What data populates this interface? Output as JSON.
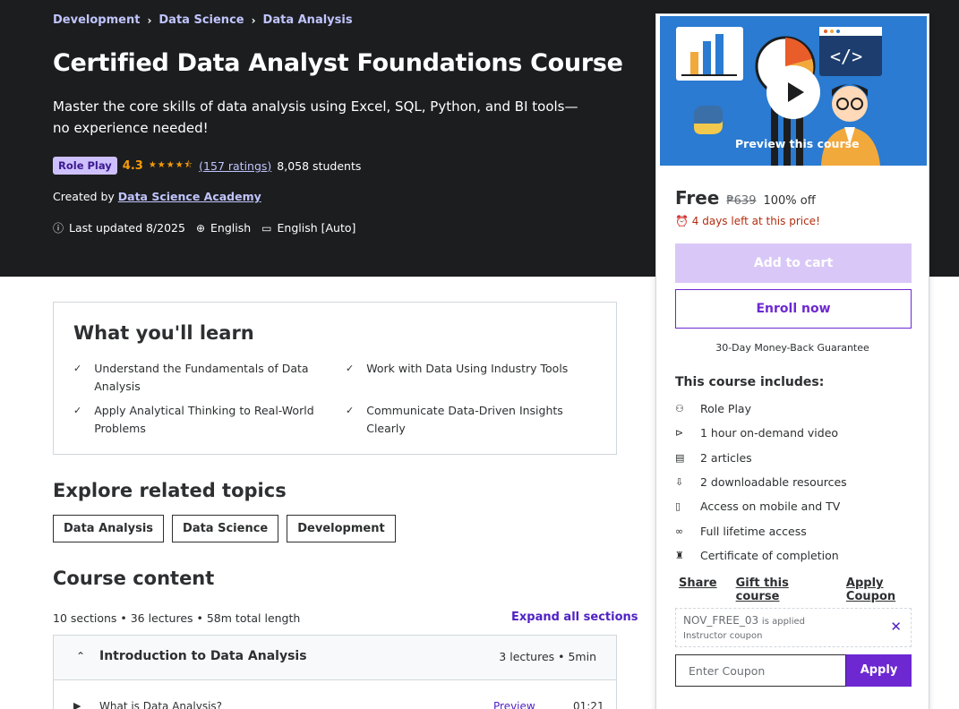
{
  "breadcrumb": [
    "Development",
    "Data Science",
    "Data Analysis"
  ],
  "course": {
    "title": "Certified Data Analyst Foundations Course",
    "subtitle": "Master the core skills of data analysis using Excel, SQL, Python, and BI tools—no experience needed!",
    "badge": "Role Play",
    "rating": "4.3",
    "rating_stars": 4.3,
    "ratings_count": "(157 ratings)",
    "students": "8,058 students",
    "created_by_label": "Created by",
    "instructor": "Data Science Academy",
    "last_updated": "Last updated 8/2025",
    "language": "English",
    "captions": "English [Auto]"
  },
  "learn": {
    "title": "What you'll learn",
    "items": [
      "Understand the Fundamentals of Data Analysis",
      "Work with Data Using Industry Tools",
      "Apply Analytical Thinking to Real-World Problems",
      "Communicate Data-Driven Insights Clearly"
    ]
  },
  "topics": {
    "title": "Explore related topics",
    "items": [
      "Data Analysis",
      "Data Science",
      "Development"
    ]
  },
  "content": {
    "title": "Course content",
    "meta": "10 sections • 36 lectures • 58m total length",
    "expand_label": "Expand all sections",
    "section": {
      "title": "Introduction to Data Analysis",
      "meta": "3 lectures • 5min"
    },
    "lecture": {
      "title": "What is Data Analysis?",
      "preview": "Preview",
      "duration": "01:21"
    }
  },
  "sidebar": {
    "preview_label": "Preview this course",
    "price": "Free",
    "original_price": "₱639",
    "discount": "100% off",
    "timer": "4 days left at this price!",
    "add_to_cart": "Add to cart",
    "enroll": "Enroll now",
    "guarantee": "30-Day Money-Back Guarantee",
    "includes_title": "This course includes:",
    "includes": [
      {
        "icon": "role-play-icon",
        "label": "Role Play"
      },
      {
        "icon": "video-icon",
        "label": "1 hour on-demand video"
      },
      {
        "icon": "article-icon",
        "label": "2 articles"
      },
      {
        "icon": "download-icon",
        "label": "2 downloadable resources"
      },
      {
        "icon": "mobile-icon",
        "label": "Access on mobile and TV"
      },
      {
        "icon": "infinity-icon",
        "label": "Full lifetime access"
      },
      {
        "icon": "trophy-icon",
        "label": "Certificate of completion"
      }
    ],
    "share": "Share",
    "gift": "Gift this course",
    "apply_coupon": "Apply Coupon",
    "coupon_code": "NOV_FREE_03",
    "coupon_applied": "is applied",
    "coupon_type": "Instructor coupon",
    "coupon_placeholder": "Enter Coupon",
    "apply": "Apply"
  },
  "colors": {
    "hero_bg": "#1c1d1f",
    "accent": "#6d28d2",
    "link_light": "#c0c4fc",
    "star": "#f69c08",
    "timer": "#b32d0f"
  }
}
